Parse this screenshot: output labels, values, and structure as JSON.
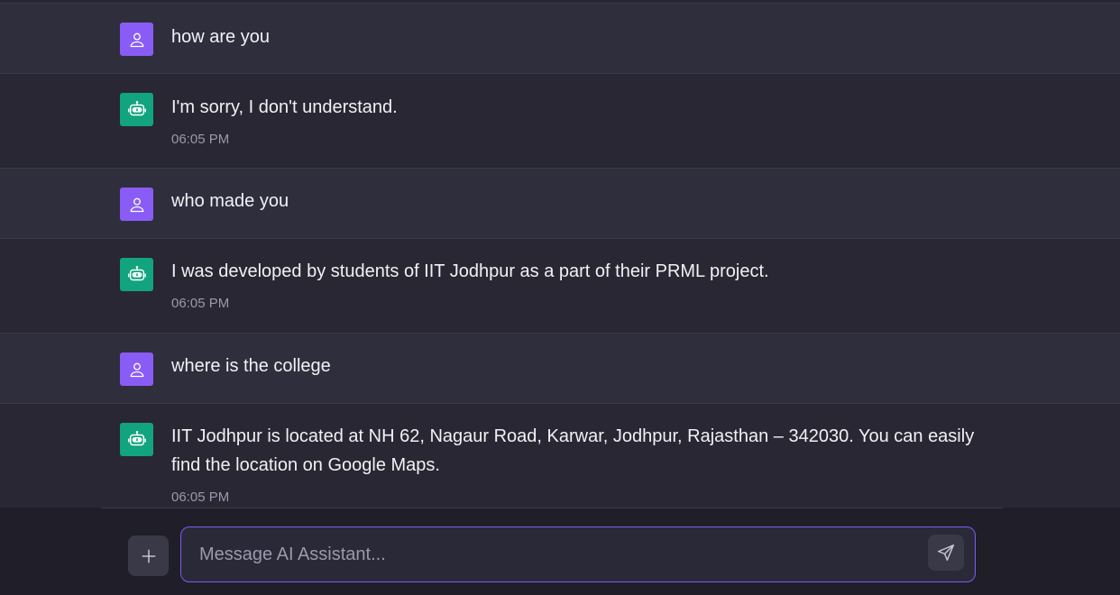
{
  "messages": [
    {
      "role": "user",
      "text": "how are you"
    },
    {
      "role": "assistant",
      "text": "I'm sorry, I don't understand.",
      "time": "06:05 PM"
    },
    {
      "role": "user",
      "text": "who made you"
    },
    {
      "role": "assistant",
      "text": "I was developed by students of IIT Jodhpur as a part of their PRML project.",
      "time": "06:05 PM"
    },
    {
      "role": "user",
      "text": "where is the college"
    },
    {
      "role": "assistant",
      "text": "IIT Jodhpur is located at NH 62, Nagaur Road, Karwar, Jodhpur, Rajasthan – 342030. You can easily find the location on Google Maps.",
      "time": "06:05 PM"
    }
  ],
  "composer": {
    "placeholder": "Message AI Assistant...",
    "value": ""
  },
  "icons": {
    "user_avatar": "user-icon",
    "assistant_avatar": "robot-icon",
    "attach": "plus-icon",
    "send": "send-icon"
  },
  "colors": {
    "user_avatar_bg": "#8a5cf6",
    "assistant_avatar_bg": "#12a37f",
    "input_border": "#7c5cf0"
  }
}
